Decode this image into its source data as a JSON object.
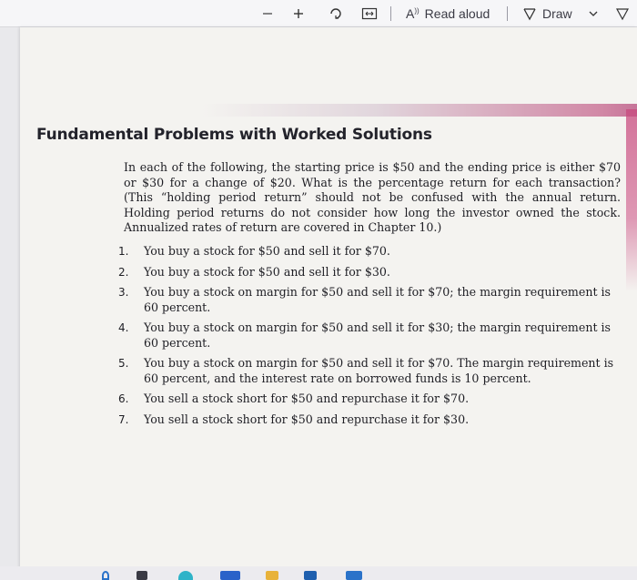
{
  "toolbar": {
    "read_aloud_label": "Read aloud",
    "draw_label": "Draw"
  },
  "document": {
    "heading": "Fundamental Problems with Worked Solutions",
    "intro": "In each of the following, the starting price is $50 and the ending price is either $70 or $30 for a change of $20. What is the percentage return for each transaction? (This “holding period return” should not be confused with the annual return. Holding period returns do not consider how long the investor owned the stock. Annualized rates of return are covered in Chapter 10.)",
    "problems": [
      {
        "num": "1.",
        "text": "You buy a stock for $50 and sell it for $70."
      },
      {
        "num": "2.",
        "text": "You buy a stock for $50 and sell it for $30."
      },
      {
        "num": "3.",
        "text": "You buy a stock on margin for $50 and sell it for $70; the margin requirement is 60 percent."
      },
      {
        "num": "4.",
        "text": "You buy a stock on margin for $50 and sell it for $30; the margin requirement is 60 percent."
      },
      {
        "num": "5.",
        "text": "You buy a stock on margin for $50 and sell it for $70. The margin requirement is 60 percent, and the interest rate on borrowed funds is 10 percent."
      },
      {
        "num": "6.",
        "text": "You sell a stock short for $50 and repurchase it for $70."
      },
      {
        "num": "7.",
        "text": "You sell a stock short for $50 and repurchase it for $30."
      }
    ]
  },
  "colors": {
    "accent_pink": "#c8487d",
    "text": "#1e1e24"
  }
}
